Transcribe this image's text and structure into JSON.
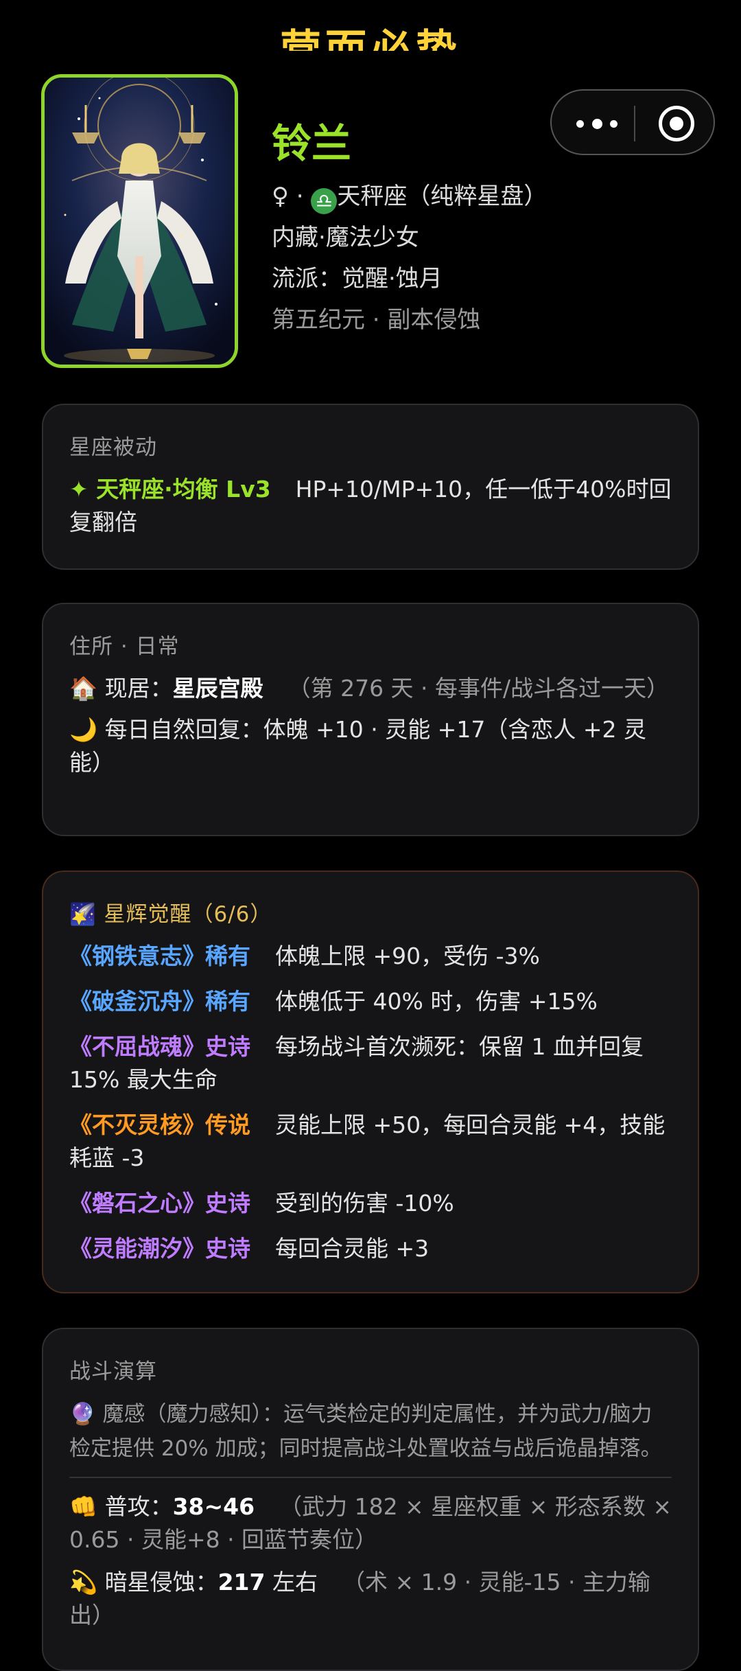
{
  "banner": "营而必势",
  "profile": {
    "name": "铃兰",
    "gender_symbol": "♀ ·",
    "zodiac_badge": "♎",
    "zodiac": "天秤座（纯粹星盘）",
    "class": "内藏·魔法少女",
    "school": "流派：觉醒·蚀月",
    "era": "第五纪元 · 副本侵蚀"
  },
  "passive": {
    "title": "星座被动",
    "skill_name": "✦ 天秤座·均衡 Lv3",
    "skill_desc": "HP+10/MP+10，任一低于40%时回复翻倍"
  },
  "residence": {
    "title": "住所 · 日常",
    "home_icon": "🏠",
    "home_label": "现居：",
    "home_name": "星辰宫殿",
    "home_note": "（第 276 天 · 每事件/战斗各过一天）",
    "moon_icon": "🌙",
    "daily": "每日自然回复：体魄 +10 · 灵能 +17（含恋人 +2 灵能）"
  },
  "awakening": {
    "icon": "🌠",
    "title": "星辉觉醒（6/6）",
    "items": [
      {
        "name": "《钢铁意志》稀有",
        "desc": "体魄上限 +90，受伤 -3%"
      },
      {
        "name": "《破釜沉舟》稀有",
        "desc": "体魄低于 40% 时，伤害 +15%"
      },
      {
        "name": "《不屈战魂》史诗",
        "desc": "每场战斗首次濒死：保留 1 血并回复 15% 最大生命"
      },
      {
        "name": "《不灭灵核》传说",
        "desc": "灵能上限 +50，每回合灵能 +4，技能耗蓝 -3"
      },
      {
        "name": "《磐石之心》史诗",
        "desc": "受到的伤害 -10%"
      },
      {
        "name": "《灵能潮汐》史诗",
        "desc": "每回合灵能 +3"
      }
    ]
  },
  "combat": {
    "title": "战斗演算",
    "orb_icon": "🔮",
    "sense": "魔感（魔力感知）：运气类检定的判定属性，并为武力/脑力检定提供 20% 加成；同时提高战斗处置收益与战后诡晶掉落。",
    "fist_icon": "👊",
    "attack_label": "普攻：",
    "attack_value": "38~46",
    "attack_note": "（武力 182 × 星座权重 × 形态系数 × 0.65 · 灵能+8 · 回蓝节奏位）",
    "star_icon": "💫",
    "skill_label": "暗星侵蚀：",
    "skill_value": "217",
    "skill_suffix": " 左右",
    "skill_note": "（术 × 1.9 · 灵能-15 · 主力输出）"
  },
  "colors": {
    "accent_green": "#9be22a",
    "banner_yellow": "#ffd23a",
    "rare_blue": "#59a6ff",
    "epic_purple": "#c07cff",
    "legend_orange": "#ff9a22"
  }
}
